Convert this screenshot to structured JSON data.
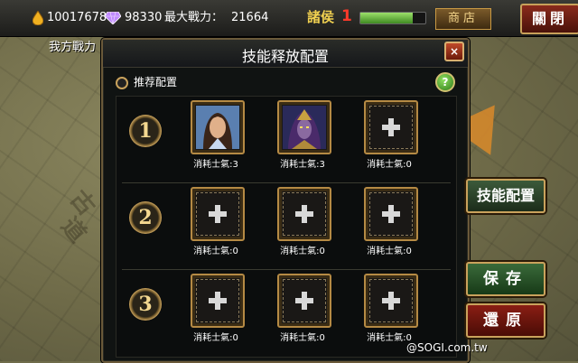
{
  "topbar": {
    "gold": "10017678",
    "gems": "98330",
    "max_power_label": "最大戰力：",
    "max_power": "21664",
    "vip_label": "諸侯",
    "vip_level": "1",
    "vip_progress": 0.8,
    "shop_label": "商店",
    "close_label": "關閉"
  },
  "our_power_label": "我方戰力",
  "dialog": {
    "title": "技能释放配置",
    "close_label": "×",
    "recommend_label": "推荐配置",
    "help_label": "?",
    "rows": [
      {
        "number": "1",
        "slots": [
          {
            "hero": "hero-warrior",
            "cost": "消耗士氣:3"
          },
          {
            "hero": "hero-sorcerer",
            "cost": "消耗士氣:3"
          },
          {
            "hero": null,
            "cost": "消耗士氣:0"
          }
        ]
      },
      {
        "number": "2",
        "slots": [
          {
            "hero": null,
            "cost": "消耗士氣:0"
          },
          {
            "hero": null,
            "cost": "消耗士氣:0"
          },
          {
            "hero": null,
            "cost": "消耗士氣:0"
          }
        ]
      },
      {
        "number": "3",
        "slots": [
          {
            "hero": null,
            "cost": "消耗士氣:0"
          },
          {
            "hero": null,
            "cost": "消耗士氣:0"
          },
          {
            "hero": null,
            "cost": "消耗士氣:0"
          }
        ]
      }
    ]
  },
  "side_buttons": {
    "config": "技能配置",
    "save": "保存",
    "restore": "還原"
  },
  "watermark": "@SOGI.com.tw",
  "colors": {
    "accent_gold": "#c9a25c",
    "vip_red": "#ff3a2a",
    "vip_yellow": "#f0d050"
  }
}
